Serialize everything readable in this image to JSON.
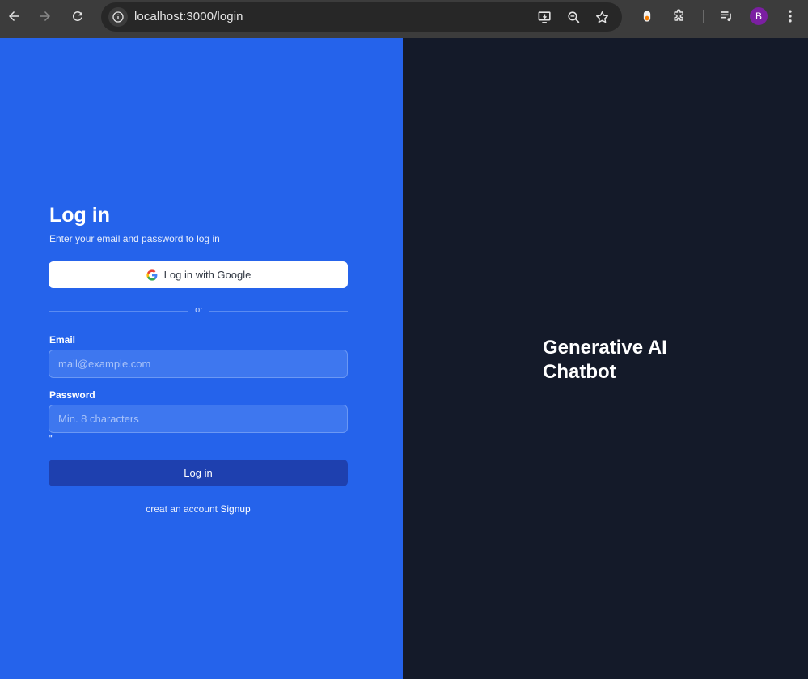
{
  "browser": {
    "url": "localhost:3000/login",
    "profile_initial": "B",
    "icons": [
      "back-icon",
      "forward-icon",
      "reload-icon",
      "site-info-icon",
      "install-app-icon",
      "zoom-icon",
      "bookmark-star-icon",
      "extension-icon",
      "puzzle-icon",
      "media-icon",
      "menu-icon"
    ]
  },
  "login": {
    "title": "Log in",
    "subtitle": "Enter your email and password to log in",
    "google_button": "Log in with Google",
    "divider": "or",
    "email_label": "Email",
    "email_placeholder": "mail@example.com",
    "password_label": "Password",
    "password_placeholder": "Min. 8 characters",
    "stray_mark": "\"",
    "submit_button": "Log in",
    "signup_prompt": "creat an account",
    "signup_link": "Signup"
  },
  "brand": {
    "title": "Generative AI Chatbot"
  },
  "colors": {
    "left_panel": "#2563eb",
    "right_panel": "#141a29",
    "submit_button": "#1e40af",
    "avatar": "#7b1fa2"
  }
}
